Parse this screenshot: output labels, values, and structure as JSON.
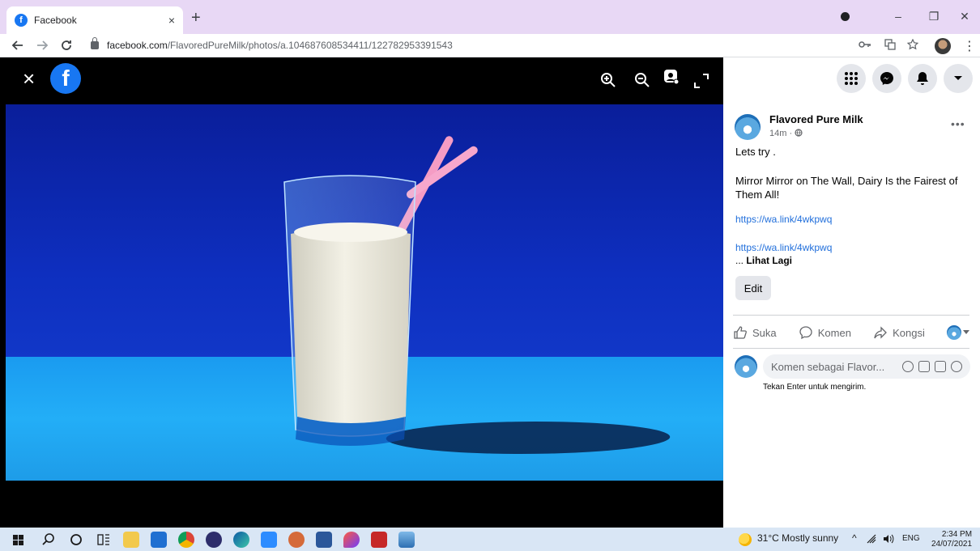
{
  "browser": {
    "tab_title": "Facebook",
    "tab_close": "×",
    "new_tab": "+",
    "url_host": "facebook.com",
    "url_path": "/FlavoredPureMilk/photos/a.104687608534411/122782953391543",
    "min_glyph": "–",
    "max_glyph": "❐",
    "close_glyph": "✕"
  },
  "viewer": {
    "close_glyph": "×",
    "logo_glyph": "f"
  },
  "post": {
    "page_name": "Flavored Pure Milk",
    "time": "14m · ",
    "more": "•••",
    "line1": "Lets try .",
    "line2": "Mirror Mirror on The Wall, Dairy Is the Fairest of Them All!",
    "link1": "https://wa.link/4wkpwq",
    "link2": "https://wa.link/4wkpwq",
    "see_more_prefix": "... ",
    "see_more": "Lihat Lagi",
    "edit_label": "Edit"
  },
  "actions": {
    "like": "Suka",
    "comment": "Komen",
    "share": "Kongsi"
  },
  "comment": {
    "placeholder": "Komen sebagai Flavor...",
    "hint": "Tekan Enter untuk mengirim."
  },
  "taskbar": {
    "weather": "31°C  Mostly sunny",
    "tray_chevron": "^",
    "lang": "ENG",
    "time": "2:34 PM",
    "date": "24/07/2021"
  },
  "colors": {
    "facebook_blue": "#1877f2",
    "tab_strip": "#e8d8f5",
    "link": "#216fdb"
  }
}
